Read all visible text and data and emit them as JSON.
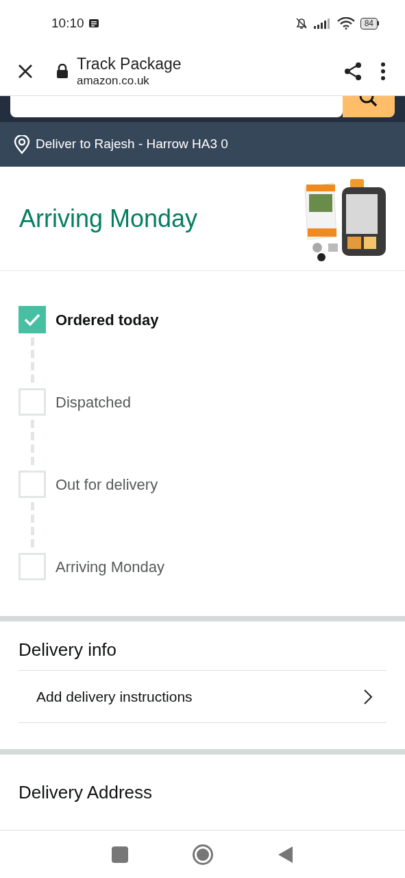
{
  "status_bar": {
    "time": "10:10",
    "battery": "84"
  },
  "toolbar": {
    "title": "Track Package",
    "url": "amazon.co.uk"
  },
  "location_bar": {
    "text": "Deliver to Rajesh - Harrow HA3 0"
  },
  "header": {
    "title": "Arriving Monday"
  },
  "steps": [
    {
      "label": "Ordered today",
      "checked": true
    },
    {
      "label": "Dispatched",
      "checked": false
    },
    {
      "label": "Out for delivery",
      "checked": false
    },
    {
      "label": "Arriving Monday",
      "checked": false
    }
  ],
  "delivery_info": {
    "title": "Delivery info",
    "rows": [
      {
        "label": "Add delivery instructions"
      }
    ]
  },
  "delivery_address": {
    "title": "Delivery Address"
  }
}
